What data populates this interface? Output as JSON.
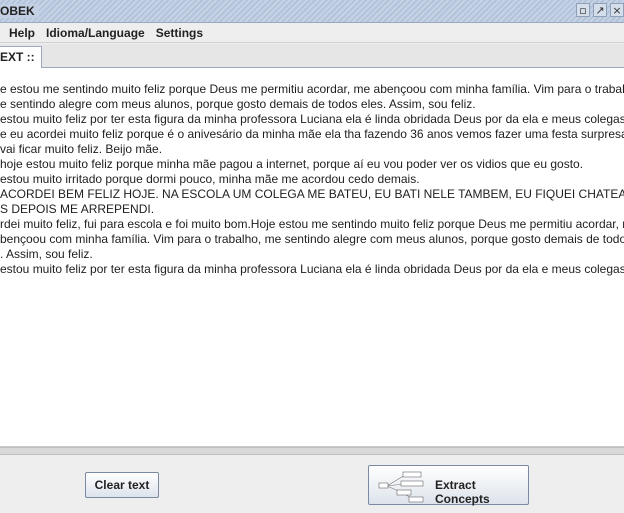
{
  "window": {
    "title": "OBEK",
    "controls": [
      "restore-icon",
      "popout-icon",
      "close-icon"
    ]
  },
  "menubar": {
    "items": [
      "Help",
      "Idioma/Language",
      "Settings"
    ]
  },
  "tabs": [
    {
      "label": "EXT ::",
      "active": true
    }
  ],
  "text_area": {
    "lines": [
      "e estou me sentindo muito feliz porque Deus me permitiu acordar, me abençoou com minha família. Vim para o trabalho",
      "e sentindo alegre com meus alunos, porque gosto demais de todos eles. Assim, sou feliz.",
      "estou muito feliz por ter esta figura da minha professora Luciana ela é linda obridada Deus por da ela e meus colegas.",
      "e eu acordei muito feliz porque é o anivesário da minha mãe ela tha fazendo 36 anos vemos fazer uma festa surpresa.",
      "vai ficar muito feliz. Beijo mãe.",
      "hoje estou muito feliz porque minha mãe pagou a internet, porque aí eu vou poder ver os vidios que eu gosto.",
      "estou muito irritado porque dormi pouco, minha mãe me acordou cedo demais.",
      "ACORDEI BEM FELIZ HOJE. NA ESCOLA UM COLEGA ME BATEU, EU BATI NELE TAMBEM, EU FIQUEI CHATEADO,",
      "S DEPOIS ME ARREPENDI.",
      "rdei muito feliz, fui para escola e foi muito bom.Hoje estou me sentindo muito feliz porque Deus me permitiu acordar, m",
      "bençoou com minha família. Vim para o trabalho, me sentindo alegre com meus alunos, porque gosto demais de todos",
      ". Assim, sou feliz.",
      "estou muito feliz por ter esta figura da minha professora Luciana ela é linda obridada Deus por da ela e meus colegas."
    ]
  },
  "buttons": {
    "clear_label": "Clear text",
    "extract_label": "Extract Concepts",
    "extract_icon": "concept-map-icon"
  }
}
